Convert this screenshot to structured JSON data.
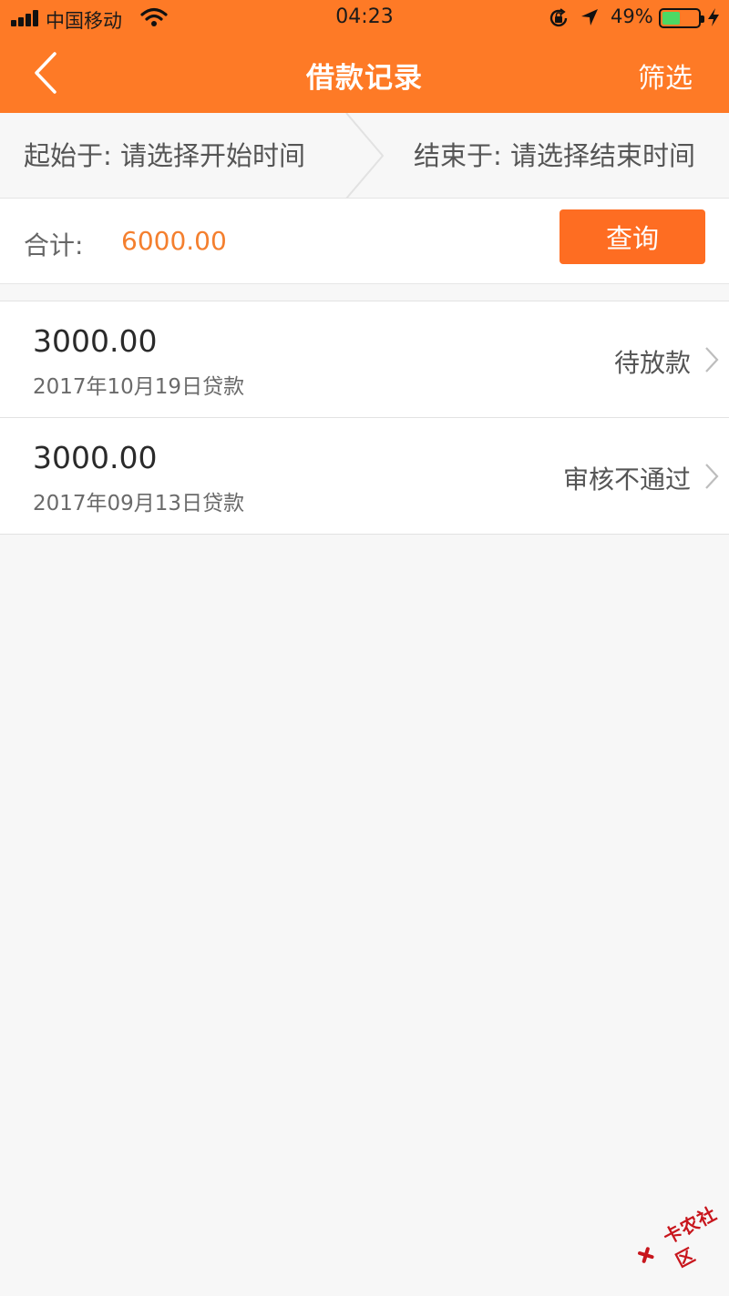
{
  "status_bar": {
    "carrier": "中国移动",
    "time": "04:23",
    "battery_percent": "49%",
    "battery_level": 0.49,
    "icons": [
      "signal-icon",
      "wifi-icon",
      "rotation-lock-icon",
      "location-icon",
      "battery-icon",
      "charging-bolt-icon"
    ]
  },
  "nav": {
    "back_icon": "chevron-left-icon",
    "title": "借款记录",
    "filter_label": "筛选"
  },
  "date_filter": {
    "start": "起始于: 请选择开始时间",
    "end": "结束于: 请选择结束时间"
  },
  "summary": {
    "total_label": "合计:",
    "total_value": "6000.00",
    "query_label": "查询"
  },
  "loans": [
    {
      "amount": "3000.00",
      "date": "2017年10月19日贷款",
      "status": "待放款"
    },
    {
      "amount": "3000.00",
      "date": "2017年09月13日贷款",
      "status": "审核不通过"
    }
  ],
  "colors": {
    "header": "#fe7a26",
    "button": "#fe6d22",
    "total_value": "#f47f2e",
    "background": "#f7f7f7"
  },
  "watermark": {
    "text": "卡农社区"
  }
}
